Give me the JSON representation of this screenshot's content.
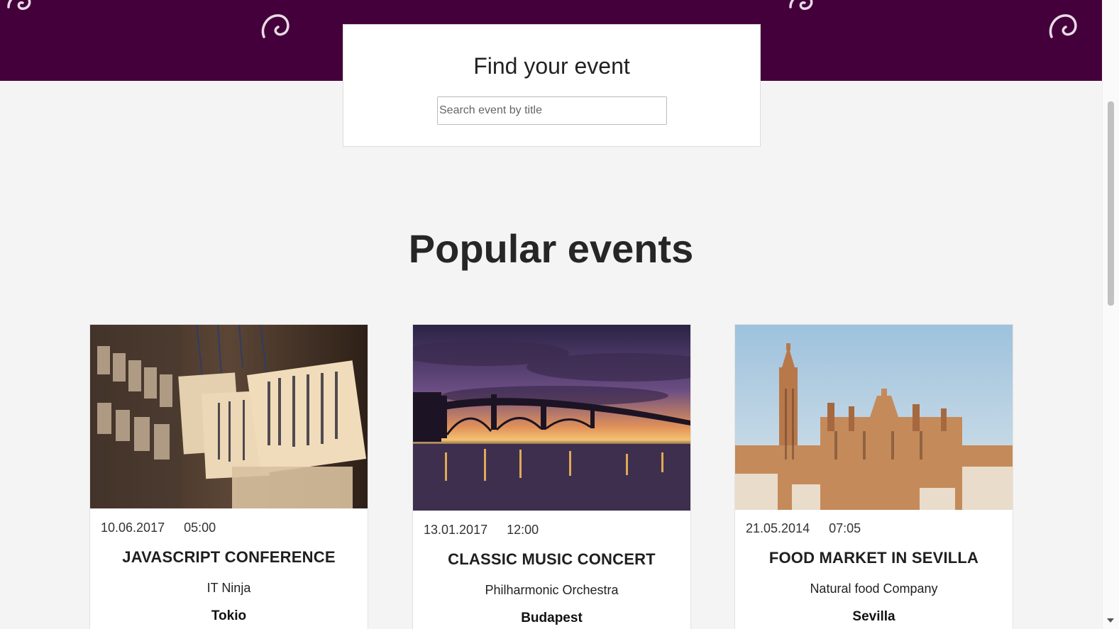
{
  "search": {
    "title": "Find your event",
    "placeholder": "Search event by title",
    "value": ""
  },
  "popular": {
    "title": "Popular events"
  },
  "events": [
    {
      "date": "10.06.2017",
      "time": "05:00",
      "title": "JAVASCRIPT CONFERENCE",
      "organizer": "IT Ninja",
      "city": "Tokio"
    },
    {
      "date": "13.01.2017",
      "time": "12:00",
      "title": "CLASSIC MUSIC CONCERT",
      "organizer": "Philharmonic Orchestra",
      "city": "Budapest"
    },
    {
      "date": "21.05.2014",
      "time": "07:05",
      "title": "FOOD MARKET IN SEVILLA",
      "organizer": "Natural food Company",
      "city": "Sevilla"
    }
  ],
  "colors": {
    "hero": "#44003a",
    "background": "#f4f4f4"
  },
  "icons": [
    "swirl-icon"
  ]
}
